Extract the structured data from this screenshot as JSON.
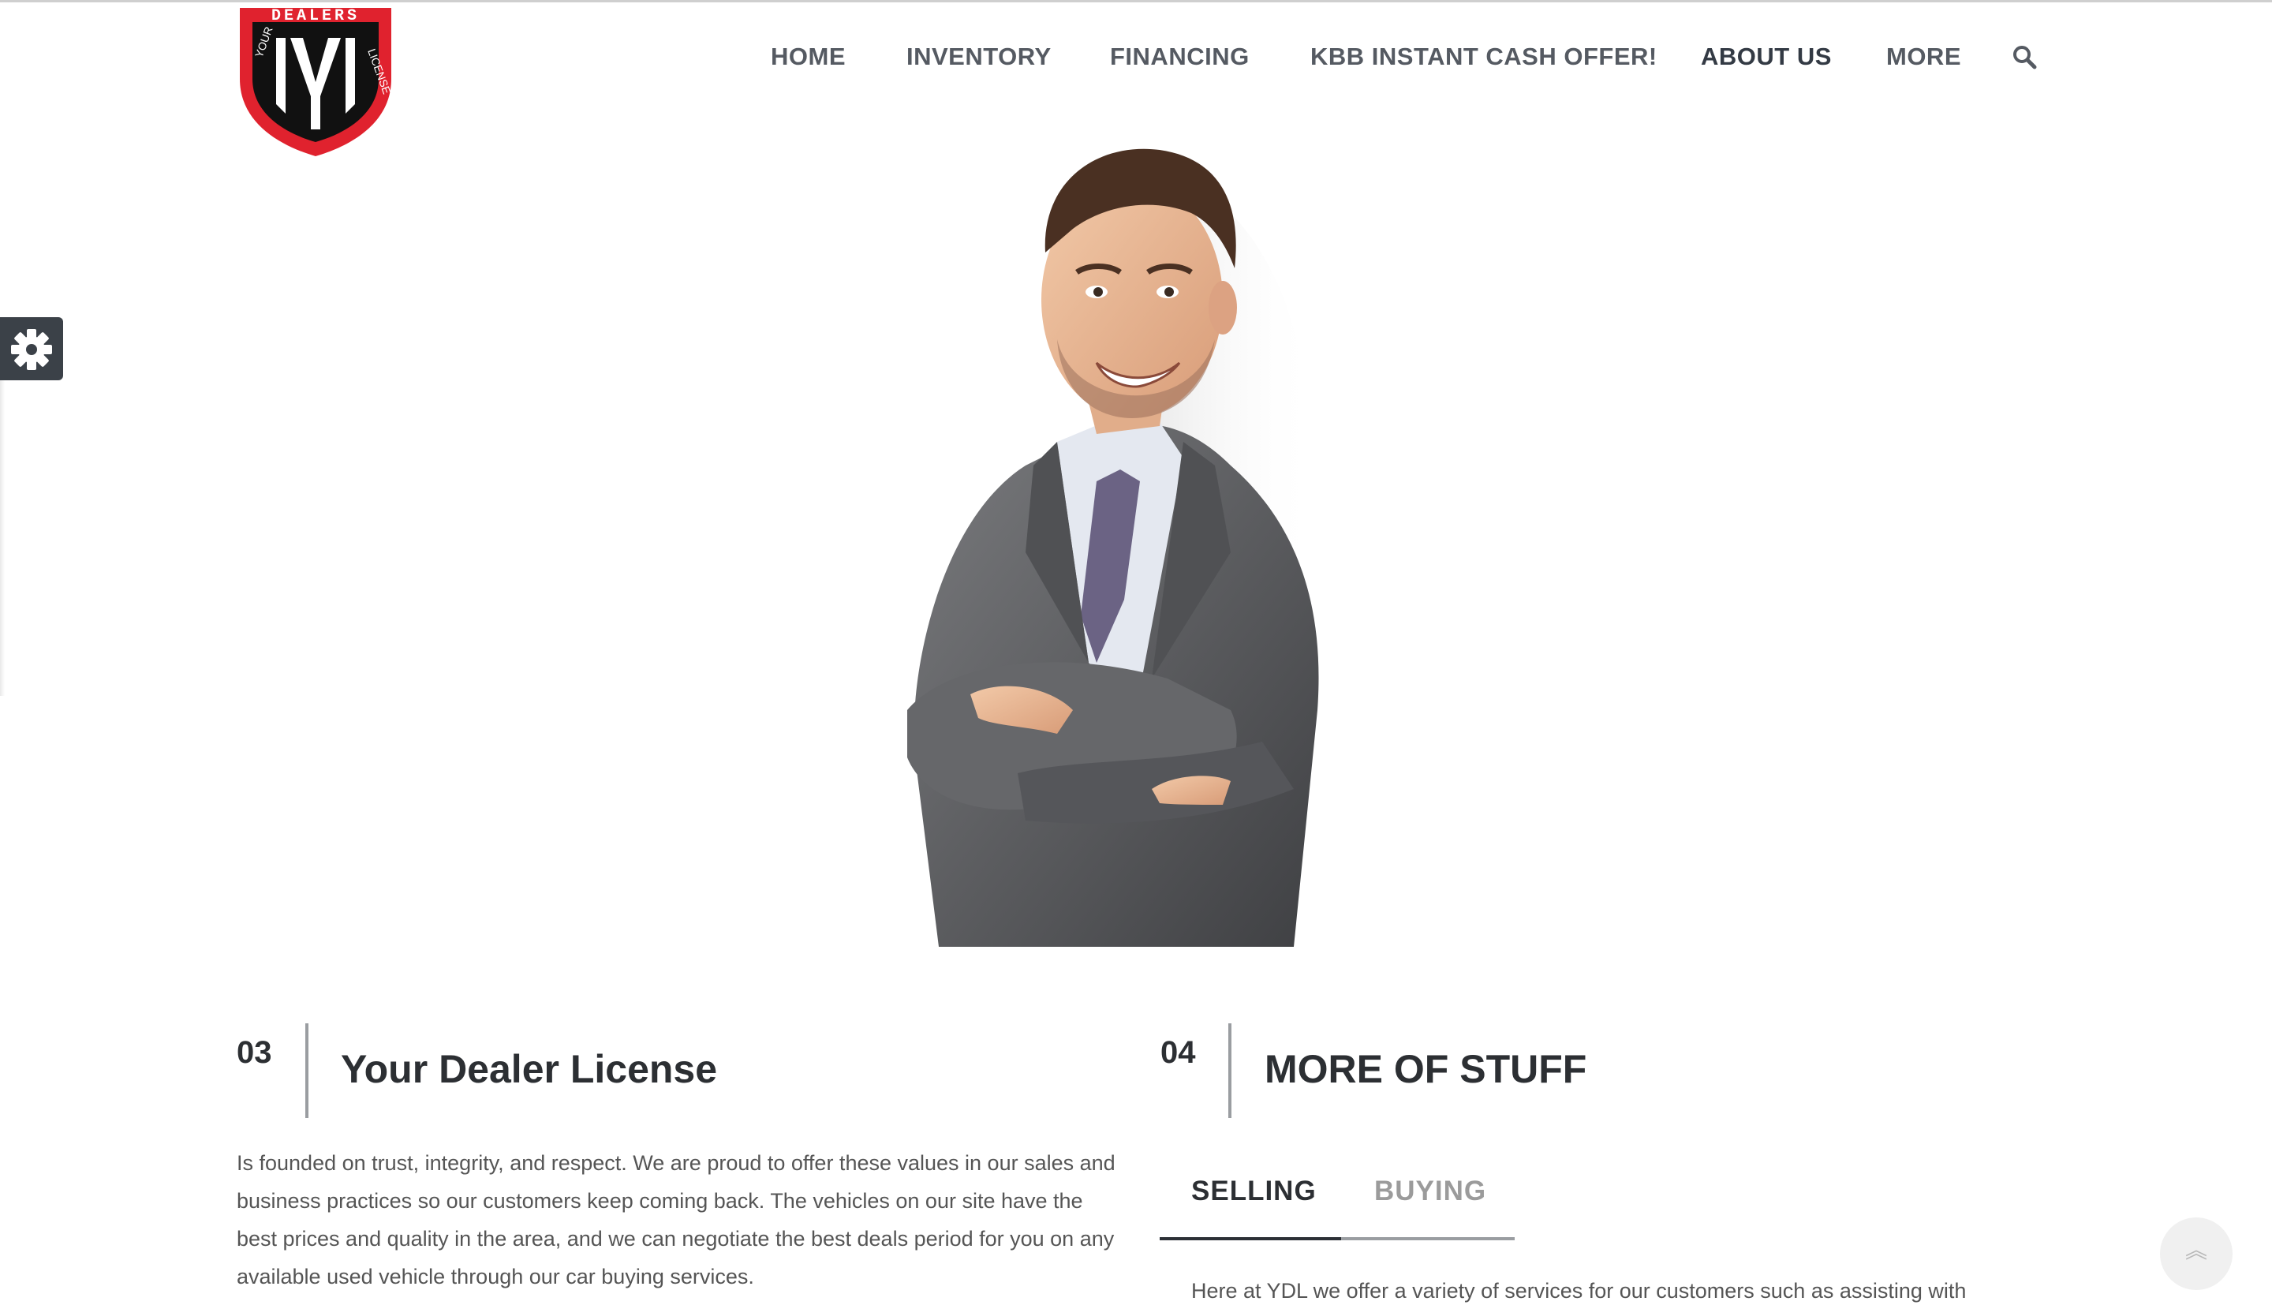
{
  "logo": {
    "top_text": "DEALERS",
    "arc_left": "YOUR",
    "arc_right": "LICENSE",
    "monogram": "YDL",
    "colors": {
      "shield_outer": "#e0222e",
      "shield_inner": "#111111"
    }
  },
  "nav": {
    "items": [
      {
        "label": "HOME"
      },
      {
        "label": "INVENTORY"
      },
      {
        "label": "FINANCING"
      },
      {
        "label": "KBB INSTANT CASH OFFER!"
      },
      {
        "label": "ABOUT US"
      },
      {
        "label": "MORE"
      }
    ],
    "search_icon": "search-icon"
  },
  "settings": {
    "icon": "gear-icon"
  },
  "hero": {
    "image": "businessman-portrait"
  },
  "section3": {
    "number": "03",
    "title": "Your Dealer License",
    "body": "Is founded on trust, integrity, and respect. We are proud to offer these values in our sales and business practices so our customers keep coming back. The vehicles on our site have the best prices and quality in the area, and we can negotiate the best deals period for you on any available used vehicle through our car buying services."
  },
  "section4": {
    "number": "04",
    "title": "MORE OF STUFF",
    "tabs": [
      {
        "label": "SELLING",
        "active": true
      },
      {
        "label": "BUYING",
        "active": false
      }
    ],
    "body": "Here at YDL we offer a variety of services for our customers such as assisting with"
  },
  "back_to_top": {
    "icon": "double-chevron-up-icon",
    "glyph": "︽"
  },
  "colors": {
    "text_dark": "#2c2f33",
    "nav_text": "#555a62",
    "body_text": "#555555",
    "tab_inactive": "#9b9b9b"
  }
}
